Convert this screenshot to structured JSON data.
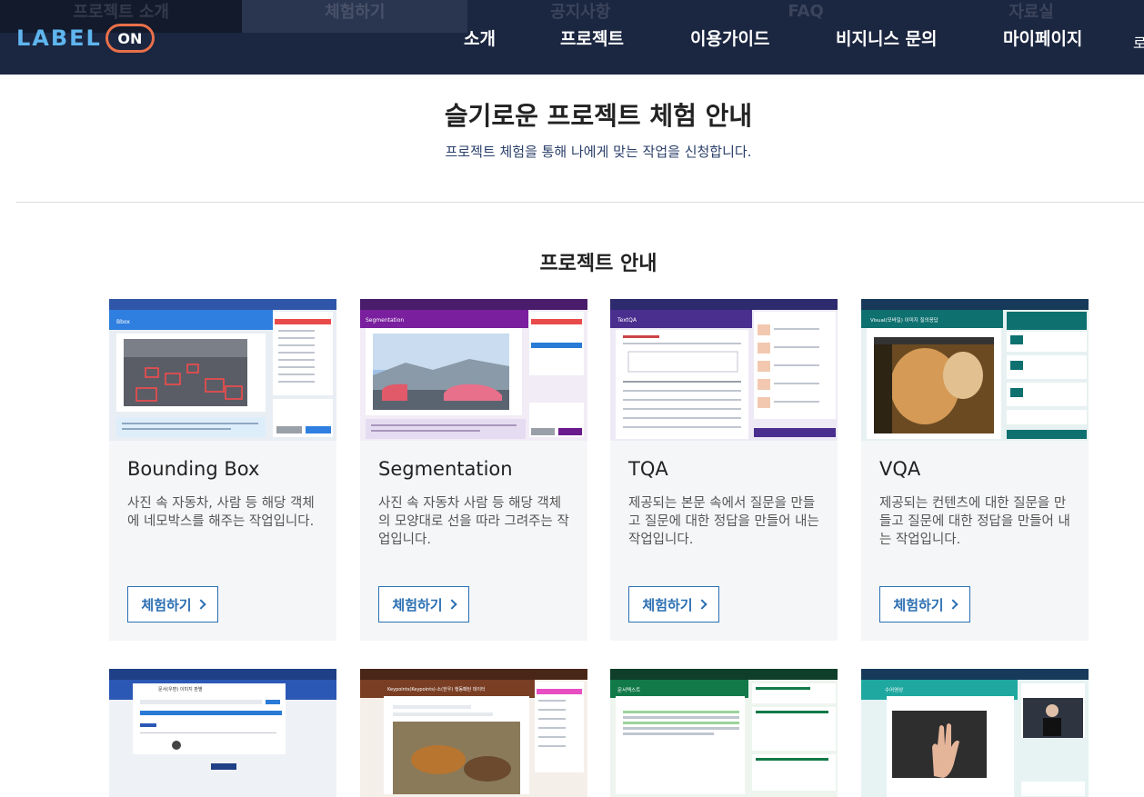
{
  "header": {
    "logo_text": "LABEL",
    "logo_on": "ON",
    "ghost_tabs": [
      "프로젝트 소개",
      "체험하기",
      "공지사항",
      "FAQ",
      "자료실"
    ],
    "nav": [
      "소개",
      "프로젝트",
      "이용가이드",
      "비지니스 문의",
      "마이페이지"
    ],
    "nav_extra": "로"
  },
  "intro": {
    "title": "슬기로운 프로젝트 체험 안내",
    "subtitle": "프로젝트 체험을 통해 나에게 맞는 작업을 신청합니다."
  },
  "section": {
    "title": "프로젝트 안내"
  },
  "cards": [
    {
      "name": "Bounding Box",
      "desc": "사진 속 자동차, 사람 등 해당 객체에 네모박스를 해주는 작업입니다.",
      "button": "체험하기",
      "thumb_label": "Bbox"
    },
    {
      "name": "Segmentation",
      "desc": "사진 속 자동차 사람 등 해당 객체의 모양대로 선을 따라 그려주는 작업입니다.",
      "button": "체험하기",
      "thumb_label": "Segmentation"
    },
    {
      "name": "TQA",
      "desc": "제공되는 본문 속에서 질문을 만들고 질문에 대한 정답을 만들어 내는 작업입니다.",
      "button": "체험하기",
      "thumb_label": "TextQA"
    },
    {
      "name": "VQA",
      "desc": "제공되는 컨텐츠에 대한 질문을 만들고 질문에 대한 정답을 만들어 내는 작업입니다.",
      "button": "체험하기",
      "thumb_label": "Visual(모바일) 이미지 질의응답"
    }
  ],
  "cards_row2": [
    {
      "thumb_label": "문서(우편) 이미지 판별"
    },
    {
      "thumb_label": "Keypoints(Keypoints)-소(한우) 행동패턴 데이터"
    },
    {
      "thumb_label": "문서텍스트"
    },
    {
      "thumb_label": "수어영상"
    }
  ],
  "colors": {
    "header_bg": "#1b2640",
    "accent_blue": "#2b6fb3",
    "logo_blue": "#5fb5ee",
    "logo_orange": "#e8704a"
  }
}
